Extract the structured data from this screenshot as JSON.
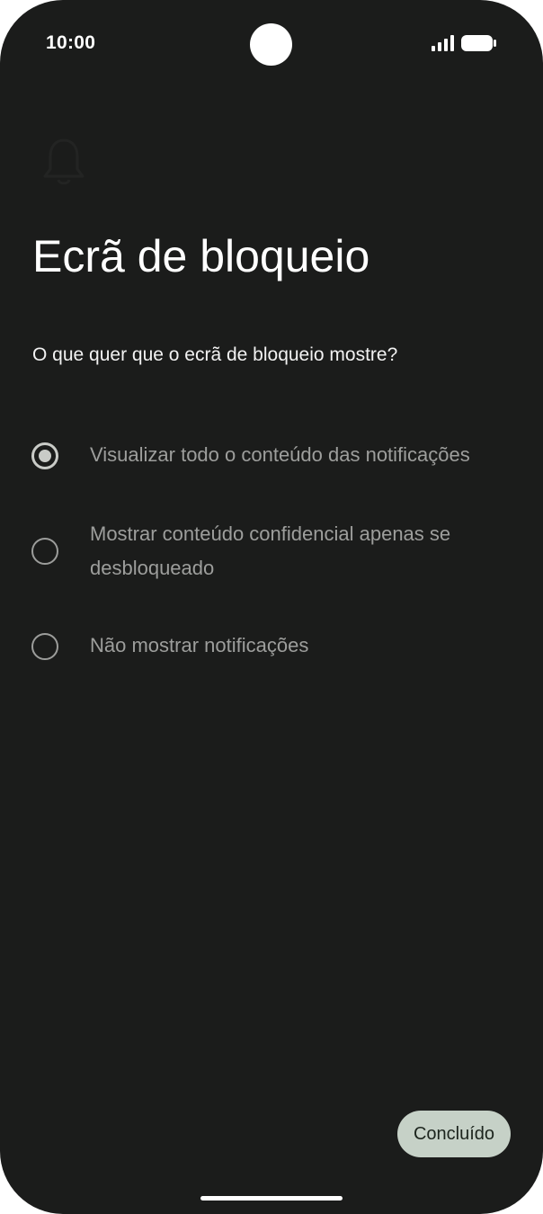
{
  "status_bar": {
    "time": "10:00",
    "signal_icon": "signal-icon",
    "battery_icon": "battery-icon"
  },
  "header": {
    "icon": "bell-icon",
    "title": "Ecrã de bloqueio"
  },
  "question": "O que quer que o ecrã de bloqueio mostre?",
  "options": [
    {
      "label": "Visualizar todo o conteúdo das notificações",
      "selected": true
    },
    {
      "label": "Mostrar conteúdo confidencial apenas se desbloqueado",
      "selected": false
    },
    {
      "label": "Não mostrar notificações",
      "selected": false
    }
  ],
  "footer": {
    "done_label": "Concluído"
  },
  "colors": {
    "background": "#1b1c1b",
    "button_bg": "#c6d1c7",
    "option_text": "#9d9e9c",
    "radio_checked": "#c9cbc7"
  }
}
